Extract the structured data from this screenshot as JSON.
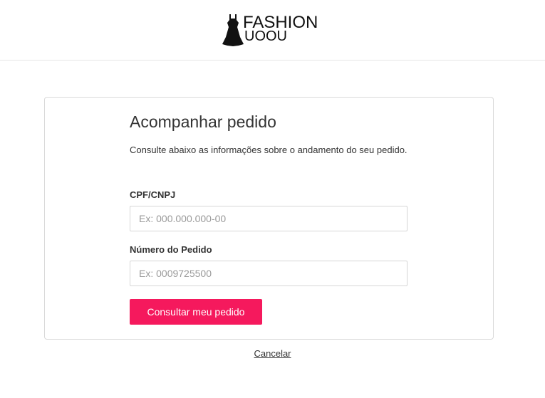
{
  "header": {
    "logo": {
      "top_text": "FASHION",
      "bottom_text": "UOOU"
    }
  },
  "form": {
    "title": "Acompanhar pedido",
    "description": "Consulte abaixo as informações sobre o andamento do seu pedido.",
    "cpf": {
      "label": "CPF/CNPJ",
      "placeholder": "Ex: 000.000.000-00",
      "value": ""
    },
    "order": {
      "label": "Número do Pedido",
      "placeholder": "Ex: 0009725500",
      "value": ""
    },
    "submit_label": "Consultar meu pedido",
    "cancel_label": "Cancelar"
  },
  "colors": {
    "accent": "#f5195d",
    "border": "#d9d9d9"
  },
  "icons": {
    "logo_mark": "dress-icon"
  }
}
